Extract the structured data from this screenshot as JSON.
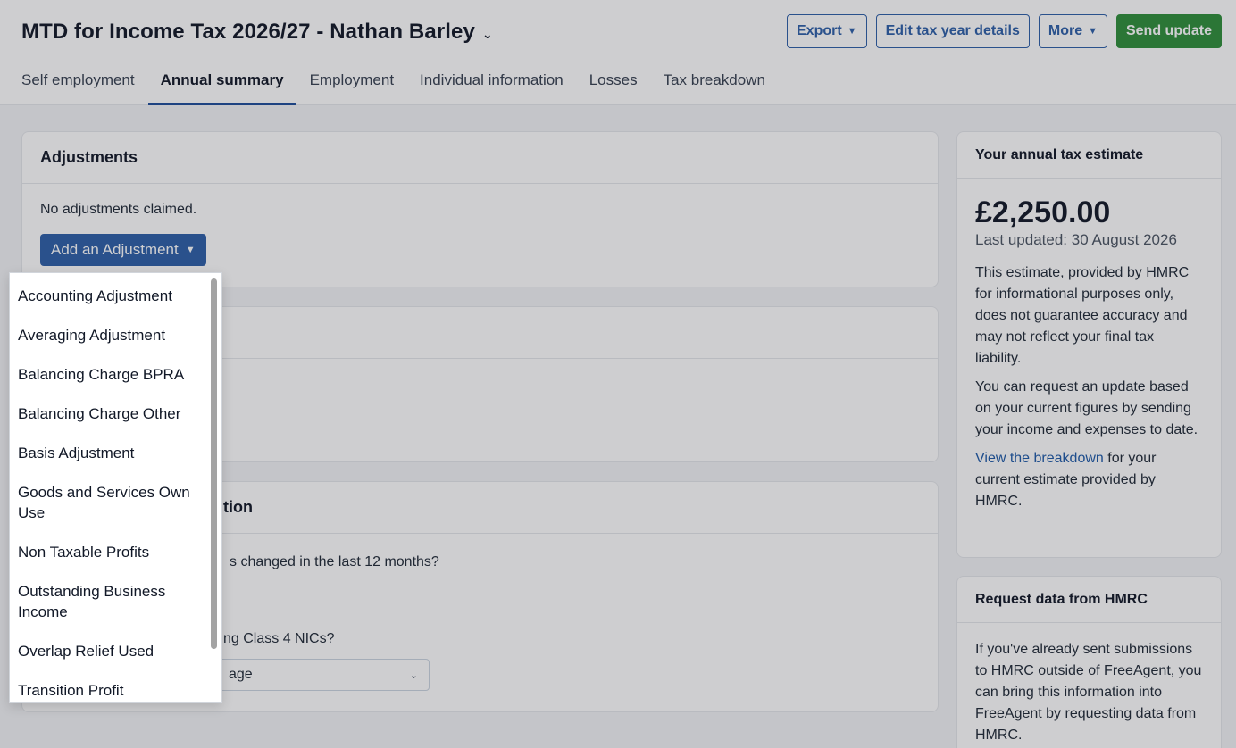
{
  "header": {
    "title": "MTD for Income Tax 2026/27 - Nathan Barley",
    "title_chevron": "⌄",
    "buttons": {
      "export": "Export",
      "edit": "Edit tax year details",
      "more": "More",
      "send": "Send update"
    }
  },
  "tabs": [
    {
      "label": "Self employment"
    },
    {
      "label": "Annual summary"
    },
    {
      "label": "Employment"
    },
    {
      "label": "Individual information"
    },
    {
      "label": "Losses"
    },
    {
      "label": "Tax breakdown"
    }
  ],
  "adjustments": {
    "title": "Adjustments",
    "empty_text": "No adjustments claimed.",
    "add_button": "Add an Adjustment"
  },
  "info_card": {
    "title_fragment": "tion",
    "question1_fragment": "s changed in the last 12 months?",
    "question2_fragment": "ng Class 4 NICs?",
    "select_value_fragment": "age"
  },
  "estimate": {
    "title": "Your annual tax estimate",
    "amount": "£2,250.00",
    "updated": "Last updated: 30 August 2026",
    "para1": "This estimate, provided by HMRC for informational purposes only, does not guarantee accuracy and may not reflect your final tax liability.",
    "para2": "You can request an update based on your current figures by sending your income and expenses to date.",
    "link": "View the breakdown",
    "para3_rest": " for your current estimate provided by HMRC."
  },
  "request": {
    "title": "Request data from HMRC",
    "body": "If you've already sent submissions to HMRC outside of FreeAgent, you can bring this information into FreeAgent by requesting data from HMRC."
  },
  "menu": {
    "items": [
      {
        "label": "Accounting Adjustment"
      },
      {
        "label": "Averaging Adjustment"
      },
      {
        "label": "Balancing Charge BPRA"
      },
      {
        "label": "Balancing Charge Other"
      },
      {
        "label": "Basis Adjustment"
      },
      {
        "label": "Goods and Services Own Use"
      },
      {
        "label": "Non Taxable Profits"
      },
      {
        "label": "Outstanding Business Income"
      },
      {
        "label": "Overlap Relief Used"
      },
      {
        "label": "Transition Profit Acceleration Amount"
      }
    ]
  }
}
